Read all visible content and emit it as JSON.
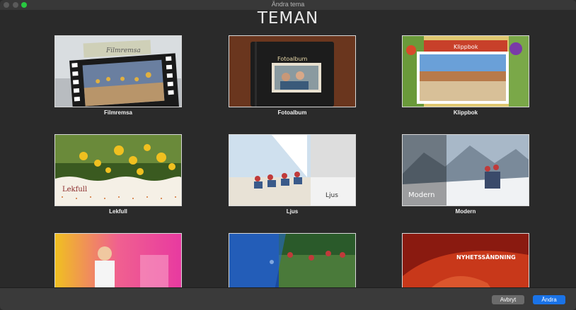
{
  "window": {
    "title": "Ändra tema"
  },
  "heading": "TEMAN",
  "themes": [
    {
      "label": "Filmremsa",
      "overlay_text": "Filmremsa"
    },
    {
      "label": "Fotoalbum",
      "overlay_text": "Fotoalbum"
    },
    {
      "label": "Klippbok",
      "overlay_text": "Klippbok"
    },
    {
      "label": "Lekfull",
      "overlay_text": "Lekfull"
    },
    {
      "label": "Ljus",
      "overlay_text": "Ljus"
    },
    {
      "label": "Modern",
      "overlay_text": "Modern"
    },
    {
      "label": "",
      "overlay_text": ""
    },
    {
      "label": "",
      "overlay_text": ""
    },
    {
      "label": "",
      "overlay_text": "NYHETSSÄNDNING"
    }
  ],
  "footer": {
    "cancel_label": "Avbryt",
    "confirm_label": "Ändra"
  },
  "colors": {
    "accent": "#1a73e8",
    "background": "#2a2a2a"
  }
}
